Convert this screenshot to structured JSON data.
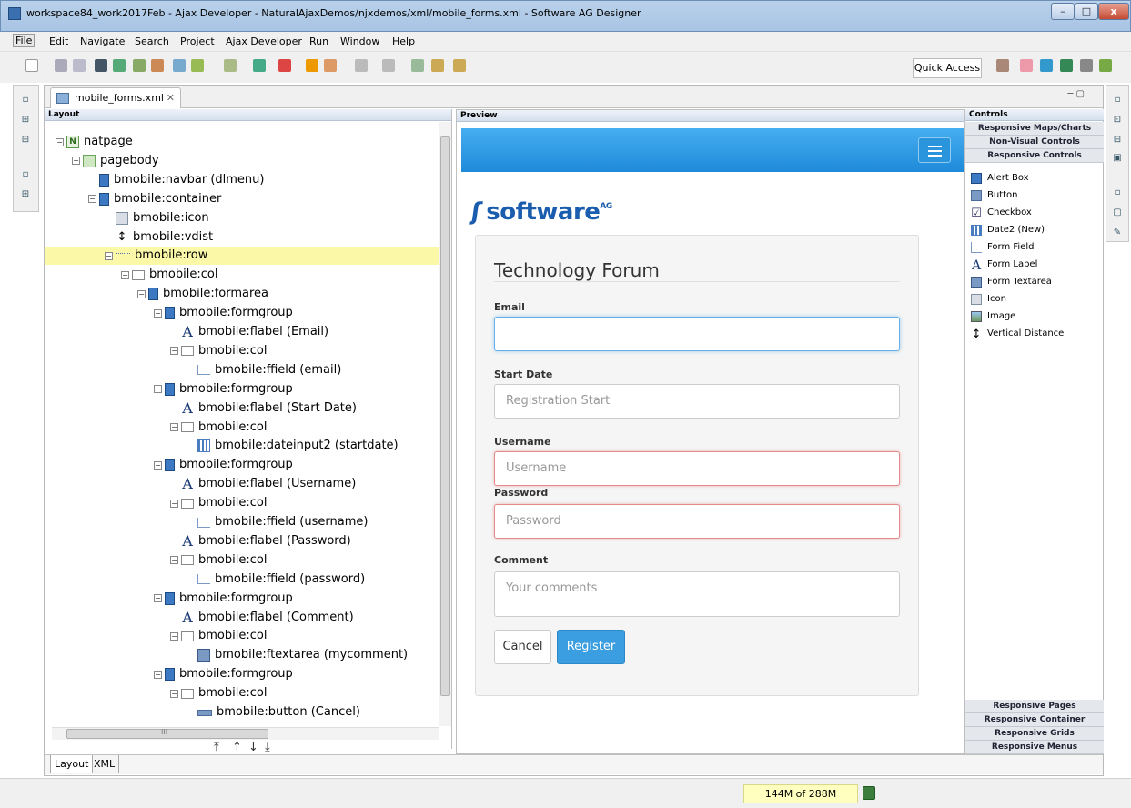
{
  "window": {
    "title": "workspace84_work2017Feb - Ajax Developer - NaturalAjaxDemos/njxdemos/xml/mobile_forms.xml - Software AG Designer",
    "minimize": "–",
    "maximize": "□",
    "close": "x"
  },
  "menu": [
    "File",
    "Edit",
    "Navigate",
    "Search",
    "Project",
    "Ajax Developer",
    "Run",
    "Window",
    "Help"
  ],
  "toolbar": {
    "quick_access": "Quick Access"
  },
  "editor": {
    "tab_label": "mobile_forms.xml",
    "tab_close": "✕",
    "controls": "─ ▢"
  },
  "layout": {
    "header": "Layout",
    "tree": [
      {
        "label": "natpage",
        "icon": "natpage-icon",
        "exp": "-"
      },
      {
        "label": "pagebody",
        "icon": "pagebody-icon",
        "exp": "-"
      },
      {
        "label": "bmobile:navbar (dlmenu)",
        "icon": "container-icon",
        "exp": ""
      },
      {
        "label": "bmobile:container",
        "icon": "container-icon",
        "exp": "-"
      },
      {
        "label": "bmobile:icon",
        "icon": "image-icon",
        "exp": ""
      },
      {
        "label": "bmobile:vdist",
        "icon": "vertical-distance-icon",
        "exp": ""
      },
      {
        "label": "bmobile:row",
        "icon": "row-icon",
        "exp": "-"
      },
      {
        "label": "bmobile:col",
        "icon": "col-icon",
        "exp": "-"
      },
      {
        "label": "bmobile:formarea",
        "icon": "container-icon",
        "exp": "-"
      },
      {
        "label": "bmobile:formgroup",
        "icon": "container-icon",
        "exp": "-"
      },
      {
        "label": "bmobile:flabel (Email)",
        "icon": "form-label-icon",
        "exp": ""
      },
      {
        "label": "bmobile:col",
        "icon": "col-icon",
        "exp": "-"
      },
      {
        "label": "bmobile:ffield (email)",
        "icon": "form-field-icon",
        "exp": ""
      },
      {
        "label": "bmobile:formgroup",
        "icon": "container-icon",
        "exp": "-"
      },
      {
        "label": "bmobile:flabel (Start Date)",
        "icon": "form-label-icon",
        "exp": ""
      },
      {
        "label": "bmobile:col",
        "icon": "col-icon",
        "exp": "-"
      },
      {
        "label": "bmobile:dateinput2 (startdate)",
        "icon": "date-icon",
        "exp": ""
      },
      {
        "label": "bmobile:formgroup",
        "icon": "container-icon",
        "exp": "-"
      },
      {
        "label": "bmobile:flabel (Username)",
        "icon": "form-label-icon",
        "exp": ""
      },
      {
        "label": "bmobile:col",
        "icon": "col-icon",
        "exp": "-"
      },
      {
        "label": "bmobile:ffield (username)",
        "icon": "form-field-icon",
        "exp": ""
      },
      {
        "label": "bmobile:flabel (Password)",
        "icon": "form-label-icon",
        "exp": ""
      },
      {
        "label": "bmobile:col",
        "icon": "col-icon",
        "exp": "-"
      },
      {
        "label": "bmobile:ffield (password)",
        "icon": "form-field-icon",
        "exp": ""
      },
      {
        "label": "bmobile:formgroup",
        "icon": "container-icon",
        "exp": "-"
      },
      {
        "label": "bmobile:flabel (Comment)",
        "icon": "form-label-icon",
        "exp": ""
      },
      {
        "label": "bmobile:col",
        "icon": "col-icon",
        "exp": "-"
      },
      {
        "label": "bmobile:ftextarea (mycomment)",
        "icon": "textarea-icon",
        "exp": ""
      },
      {
        "label": "bmobile:formgroup",
        "icon": "container-icon",
        "exp": "-"
      },
      {
        "label": "bmobile:col",
        "icon": "col-icon",
        "exp": "-"
      },
      {
        "label": "bmobile:button (Cancel)",
        "icon": "button-icon",
        "exp": ""
      }
    ],
    "selected_index": 6,
    "nav_arrows": [
      "⤒",
      "↑",
      "↓",
      "⤓"
    ],
    "hscroll_label": "III"
  },
  "preview": {
    "header": "Preview",
    "logo": "software",
    "logo_sup": "AG",
    "form": {
      "title": "Technology Forum",
      "email_label": "Email",
      "start_label": "Start Date",
      "start_placeholder": "Registration Start",
      "user_label": "Username",
      "user_placeholder": "Username",
      "pass_label": "Password",
      "pass_placeholder": "Password",
      "comment_label": "Comment",
      "comment_placeholder": "Your comments",
      "cancel": "Cancel",
      "register": "Register"
    },
    "colors": {
      "navbar": "#2a97e0",
      "primary_button": "#3a9ee0",
      "logo": "#1a5cad"
    }
  },
  "controls": {
    "header": "Controls",
    "top_categories": [
      "Responsive Maps/Charts",
      "Non-Visual Controls",
      "Responsive Controls"
    ],
    "items": [
      {
        "label": "Alert Box",
        "icon": "alert-box-icon"
      },
      {
        "label": "Button",
        "icon": "button-icon"
      },
      {
        "label": "Checkbox",
        "icon": "checkbox-icon"
      },
      {
        "label": "Date2 (New)",
        "icon": "date-icon"
      },
      {
        "label": "Form Field",
        "icon": "form-field-icon"
      },
      {
        "label": "Form Label",
        "icon": "form-label-icon"
      },
      {
        "label": "Form Textarea",
        "icon": "textarea-icon"
      },
      {
        "label": "Icon",
        "icon": "image-icon"
      },
      {
        "label": "Image",
        "icon": "picture-icon"
      },
      {
        "label": "Vertical Distance",
        "icon": "vertical-distance-icon"
      }
    ],
    "bottom_categories": [
      "Responsive Pages",
      "Responsive Container",
      "Responsive Grids",
      "Responsive Menus"
    ]
  },
  "bottom_tabs": [
    "Layout",
    "XML"
  ],
  "status": {
    "heap": "144M of 288M"
  }
}
